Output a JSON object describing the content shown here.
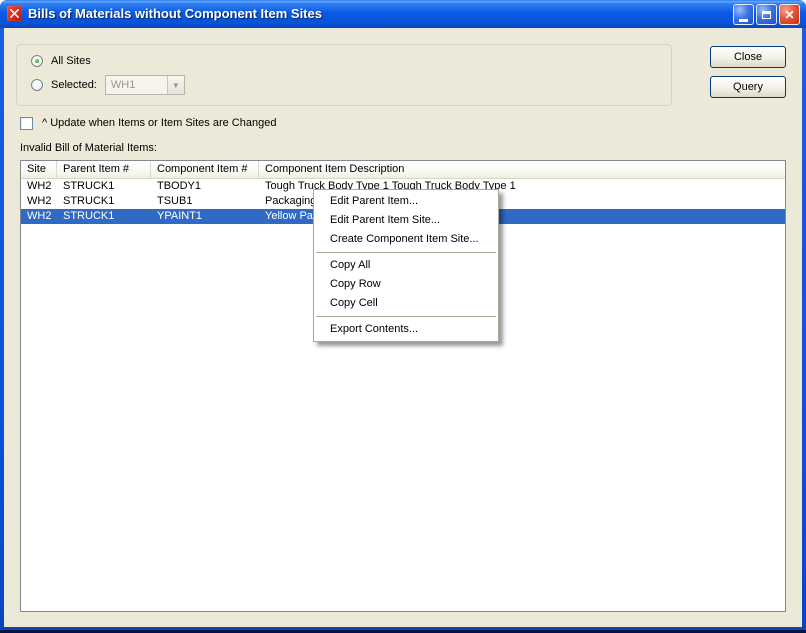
{
  "window": {
    "title": "Bills of Materials without Component Item Sites"
  },
  "icons": {
    "close_glyph": "✕",
    "dropdown_arrow": "▼"
  },
  "sites_group": {
    "all_sites_label": "All Sites",
    "selected_label": "Selected:",
    "combo_value": "WH1"
  },
  "buttons": {
    "close": "Close",
    "query": "Query"
  },
  "update_checkbox": {
    "label": "^ Update when Items or Item Sites are Changed",
    "checked": false
  },
  "table": {
    "caption": "Invalid Bill of Material Items:",
    "columns": [
      "Site",
      "Parent Item #",
      "Component Item #",
      "Component Item Description"
    ],
    "rows": [
      {
        "site": "WH2",
        "parent": "STRUCK1",
        "component": "TBODY1",
        "description": "Tough Truck Body Type 1 Tough Truck Body Type 1"
      },
      {
        "site": "WH2",
        "parent": "STRUCK1",
        "component": "TSUB1",
        "description": "Packaging"
      },
      {
        "site": "WH2",
        "parent": "STRUCK1",
        "component": "YPAINT1",
        "description": "Yellow Paint"
      }
    ],
    "selected_row_index": 2
  },
  "context_menu": {
    "items": [
      {
        "label": "Edit Parent Item..."
      },
      {
        "label": "Edit Parent Item Site..."
      },
      {
        "label": "Create Component Item Site..."
      },
      {
        "separator": true
      },
      {
        "label": "Copy All"
      },
      {
        "label": "Copy Row"
      },
      {
        "label": "Copy Cell"
      },
      {
        "separator": true
      },
      {
        "label": "Export Contents..."
      }
    ]
  },
  "colors": {
    "titlebar_blue": "#0A58E4",
    "face": "#ECE9D8",
    "selection_blue": "#316AC5",
    "close_red": "#E25232"
  }
}
